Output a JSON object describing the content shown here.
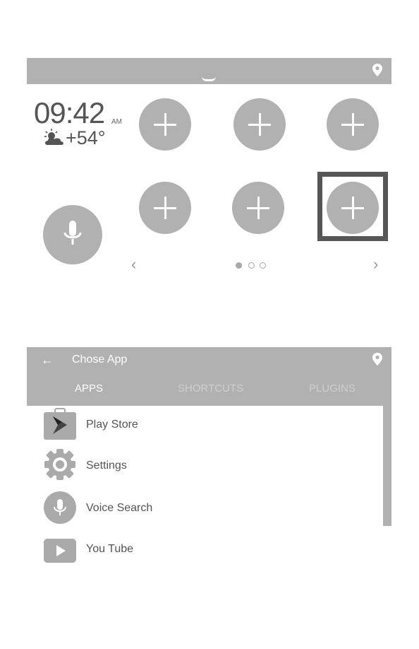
{
  "home_screen": {
    "top_bar": {
      "icons": [
        "drag-handle-icon",
        "location-pin-icon"
      ]
    },
    "clock": {
      "time": "09:42",
      "ampm": "AM"
    },
    "weather": {
      "icon": "partly-cloudy-icon",
      "temperature": "+54°"
    },
    "shortcut_slots": [
      {
        "label": "add-shortcut",
        "icon": "plus-icon"
      },
      {
        "label": "add-shortcut",
        "icon": "plus-icon"
      },
      {
        "label": "add-shortcut",
        "icon": "plus-icon"
      },
      {
        "label": "add-shortcut",
        "icon": "plus-icon"
      },
      {
        "label": "add-shortcut",
        "icon": "plus-icon"
      },
      {
        "label": "add-shortcut",
        "icon": "plus-icon",
        "highlighted": true
      }
    ],
    "voice_button": {
      "icon": "microphone-icon"
    },
    "pager": {
      "prev_icon": "‹",
      "next_icon": "›",
      "pages": 3,
      "current": 1
    }
  },
  "choose_app": {
    "title": "Chose App",
    "back_icon": "←",
    "tabs": [
      {
        "label": "APPS",
        "active": true
      },
      {
        "label": "SHORTCUTS",
        "active": false
      },
      {
        "label": "PLUGINS",
        "active": false
      }
    ],
    "apps": [
      {
        "label": "Play Store",
        "icon": "play-store-icon"
      },
      {
        "label": "Settings",
        "icon": "settings-gear-icon"
      },
      {
        "label": "Voice Search",
        "icon": "voice-search-icon"
      },
      {
        "label": "You Tube",
        "icon": "youtube-icon"
      }
    ]
  },
  "colors": {
    "bar_gray": "#b1b1b1",
    "highlight_border": "#575757",
    "text_gray": "#555555"
  }
}
